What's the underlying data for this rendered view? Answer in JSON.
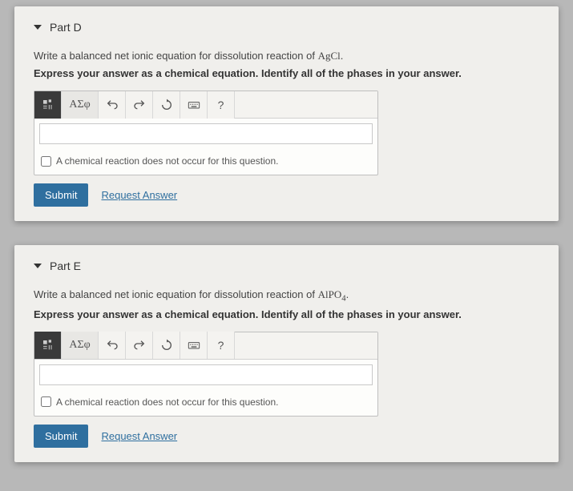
{
  "parts": [
    {
      "label": "Part D",
      "prompt_pre": "Write a balanced net ionic equation for dissolution reaction of ",
      "compound_html": "AgCl",
      "prompt_post": ".",
      "instruction": "Express your answer as a chemical equation. Identify all of the phases in your answer.",
      "toolbar": {
        "greek": "ΑΣφ",
        "help": "?"
      },
      "input_value": "",
      "no_reaction_label": "A chemical reaction does not occur for this question.",
      "submit": "Submit",
      "request": "Request Answer"
    },
    {
      "label": "Part E",
      "prompt_pre": "Write a balanced net ionic equation for dissolution reaction of ",
      "compound_html": "AlPO4",
      "prompt_post": ".",
      "instruction": "Express your answer as a chemical equation. Identify all of the phases in your answer.",
      "toolbar": {
        "greek": "ΑΣφ",
        "help": "?"
      },
      "input_value": "",
      "no_reaction_label": "A chemical reaction does not occur for this question.",
      "submit": "Submit",
      "request": "Request Answer"
    }
  ]
}
